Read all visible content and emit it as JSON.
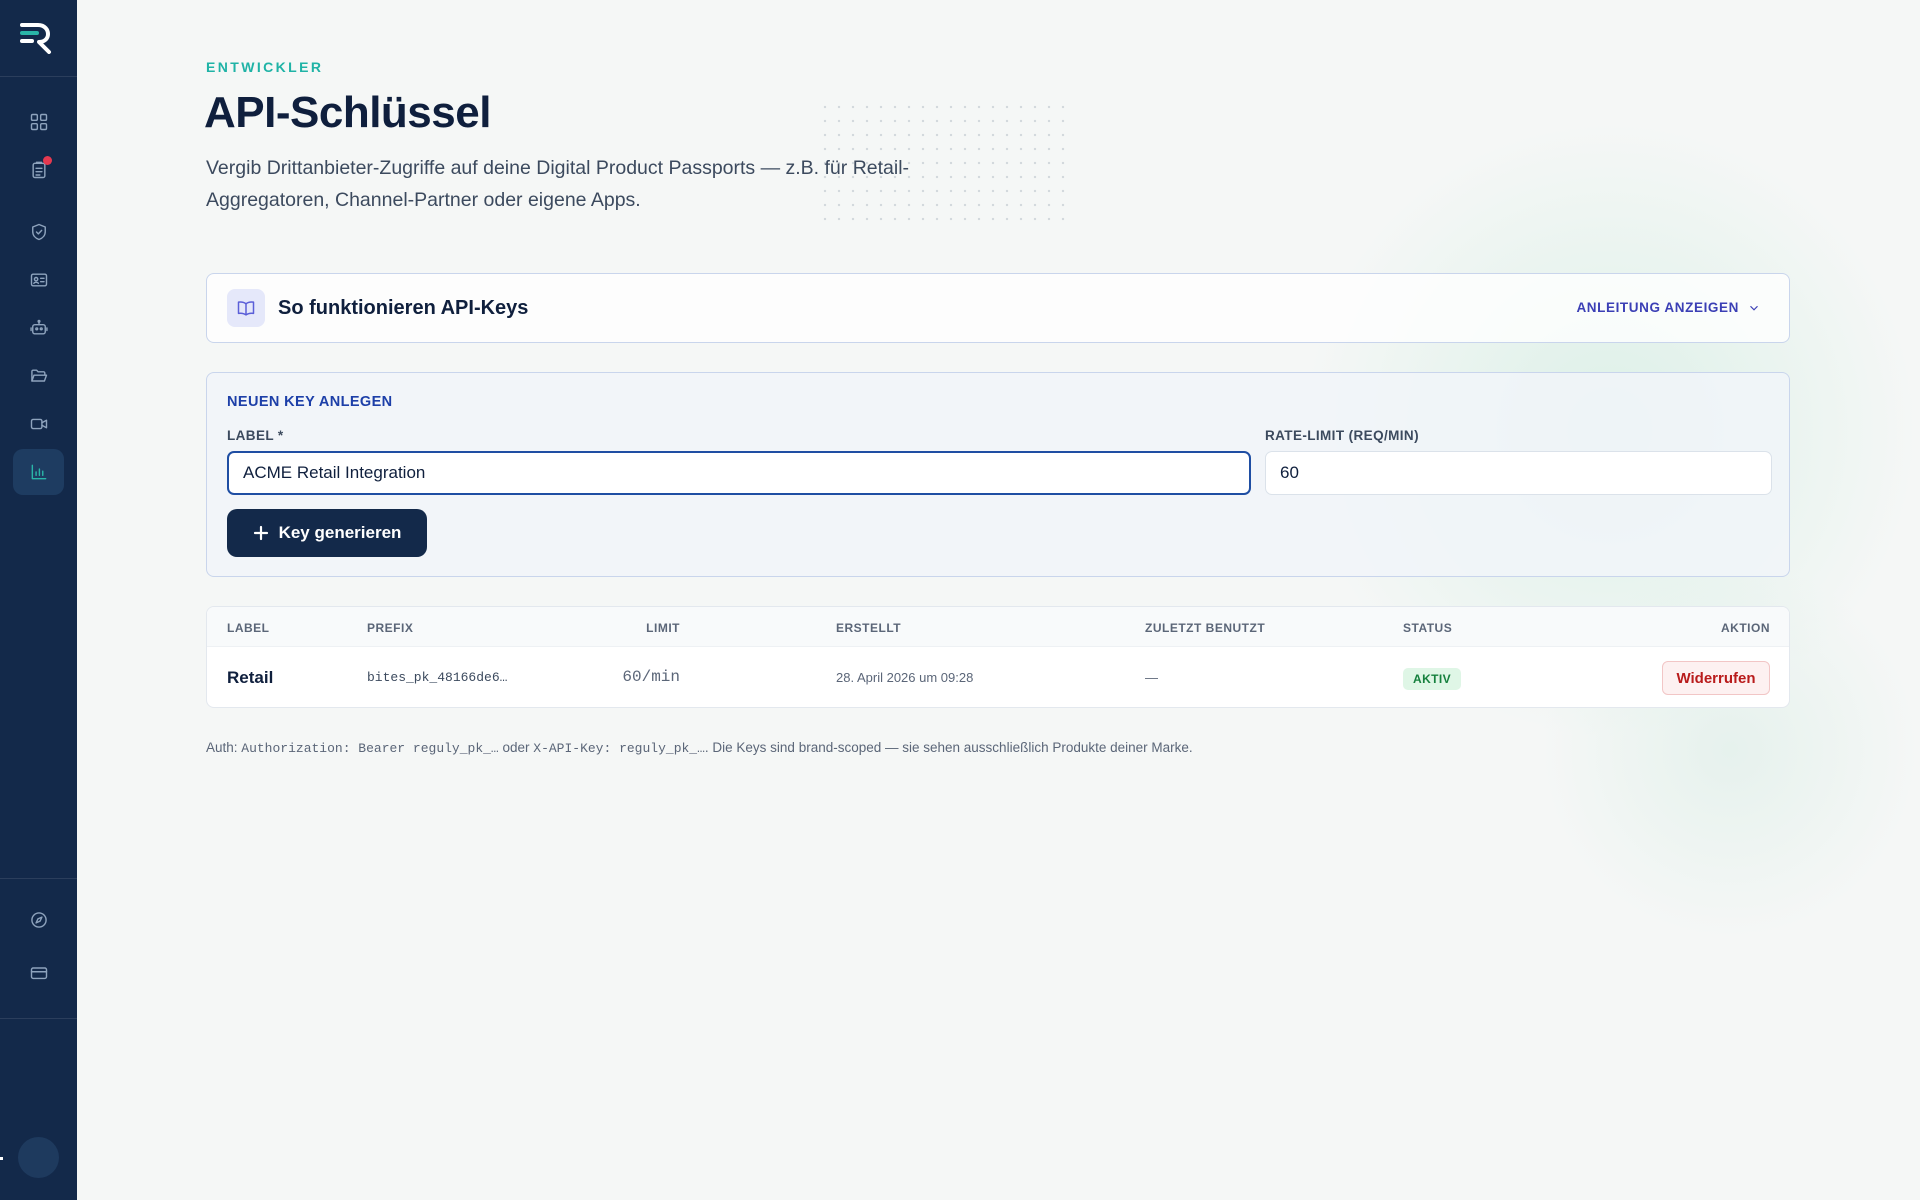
{
  "colors": {
    "sidebar_bg": "#13294a",
    "accent_teal": "#1fb3a6",
    "primary_navy": "#13294a",
    "link_indigo": "#3b3fb5",
    "danger": "#b91c1c",
    "success": "#15803d"
  },
  "sidebar": {
    "logo": "reguly-logo",
    "nav_items": [
      {
        "icon": "grid-icon",
        "active": false
      },
      {
        "icon": "clipboard-list-icon",
        "active": false,
        "notification": true
      },
      {
        "icon": "shield-check-icon",
        "active": false
      },
      {
        "icon": "id-card-icon",
        "active": false
      },
      {
        "icon": "robot-icon",
        "active": false
      },
      {
        "icon": "folder-open-icon",
        "active": false
      },
      {
        "icon": "video-camera-icon",
        "active": false
      },
      {
        "icon": "bar-chart-icon",
        "active": true
      }
    ],
    "bottom_items": [
      {
        "icon": "compass-icon"
      },
      {
        "icon": "credit-card-icon"
      }
    ]
  },
  "header": {
    "eyebrow": "ENTWICKLER",
    "title": "API-Schlüssel",
    "description": "Vergib Drittanbieter-Zugriffe auf deine Digital Product Passports — z.B. für Retail-Aggregatoren, Channel-Partner oder eigene Apps."
  },
  "info_panel": {
    "title": "So funktionieren API-Keys",
    "toggle_label": "ANLEITUNG ANZEIGEN"
  },
  "create_form": {
    "title": "NEUEN KEY ANLEGEN",
    "label_field": {
      "label": "LABEL *",
      "value": "ACME Retail Integration"
    },
    "rate_field": {
      "label": "RATE-LIMIT (REQ/MIN)",
      "value": "60"
    },
    "submit_label": "Key generieren"
  },
  "keys_table": {
    "columns": [
      "LABEL",
      "PREFIX",
      "LIMIT",
      "ERSTELLT",
      "ZULETZT BENUTZT",
      "STATUS",
      "AKTION"
    ],
    "rows": [
      {
        "label": "Retail",
        "prefix": "bites_pk_48166de6…",
        "limit": "60/min",
        "created": "28. April 2026 um 09:28",
        "last_used": "—",
        "status": "AKTIV",
        "action": "Widerrufen"
      }
    ]
  },
  "auth_note": {
    "prefix": "Auth: ",
    "header1": "Authorization: Bearer reguly_pk_…",
    "middle": " oder ",
    "header2": "X-API-Key: reguly_pk_…",
    "suffix": ". Die Keys sind brand-scoped — sie sehen ausschließlich Produkte deiner Marke."
  }
}
